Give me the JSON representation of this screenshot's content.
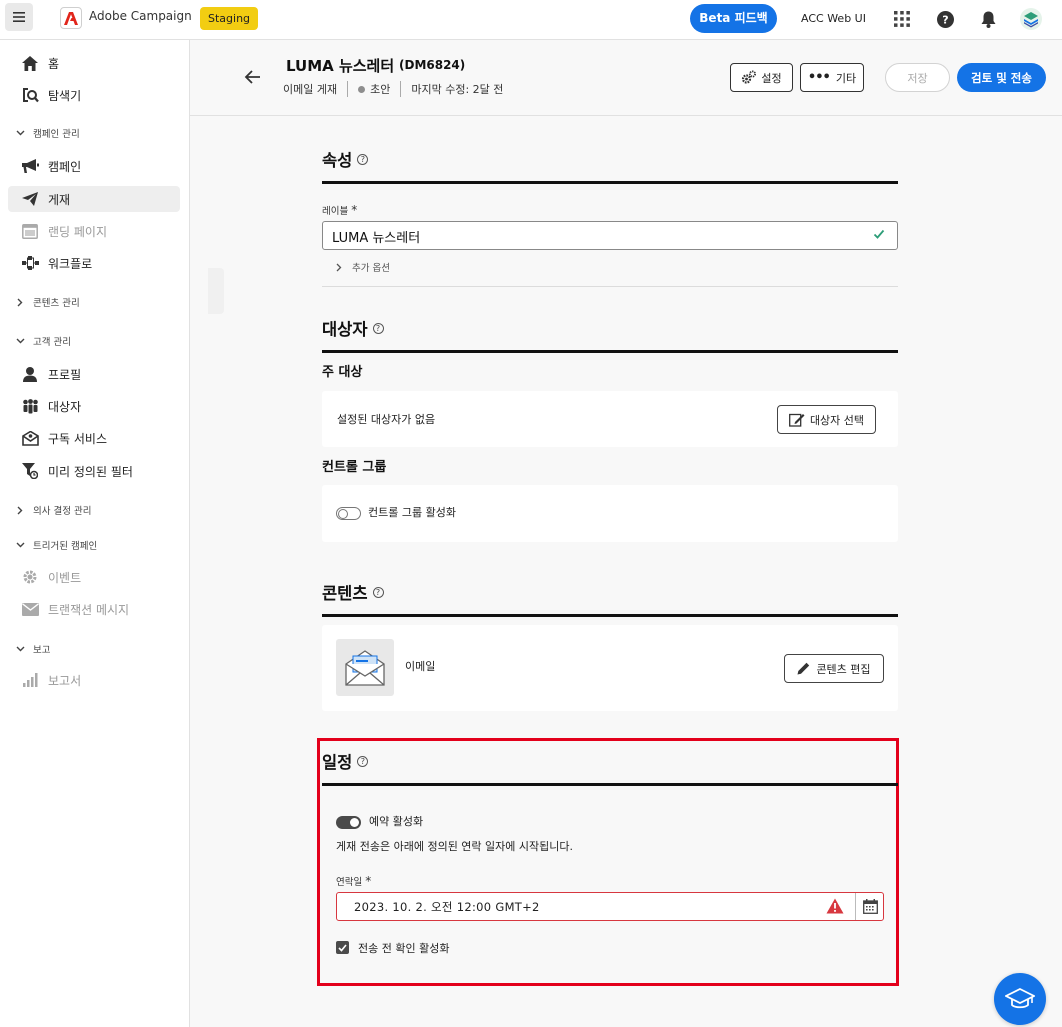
{
  "topbar": {
    "app_name": "Adobe Campaign",
    "env_badge": "Staging",
    "beta_feedback": "Beta 피드백",
    "acc_web_ui": "ACC Web UI"
  },
  "sidebar": {
    "items": [
      {
        "label": "홈",
        "icon": "home-icon"
      },
      {
        "label": "탐색기",
        "icon": "explorer-icon"
      },
      {
        "section": "캠페인 관리"
      },
      {
        "label": "캠페인",
        "icon": "megaphone-icon"
      },
      {
        "label": "게재",
        "icon": "paper-plane-icon",
        "active": true
      },
      {
        "label": "랜딩 페이지",
        "icon": "landing-page-icon",
        "disabled": true
      },
      {
        "label": "워크플로",
        "icon": "workflow-icon"
      },
      {
        "section": "콘텐츠 관리"
      },
      {
        "section": "고객 관리"
      },
      {
        "label": "프로필",
        "icon": "profile-icon"
      },
      {
        "label": "대상자",
        "icon": "audience-icon"
      },
      {
        "label": "구독 서비스",
        "icon": "subscription-icon"
      },
      {
        "label": "미리 정의된 필터",
        "icon": "filter-icon"
      },
      {
        "section": "의사 결정 관리"
      },
      {
        "section": "트리거된 캠페인"
      },
      {
        "label": "이벤트",
        "icon": "gear-icon",
        "disabled": true
      },
      {
        "label": "트랜잭션 메시지",
        "icon": "mail-icon",
        "disabled": true
      },
      {
        "section": "보고"
      },
      {
        "label": "보고서",
        "icon": "chart-icon",
        "disabled": true
      }
    ]
  },
  "header": {
    "title": "LUMA 뉴스레터",
    "id": "(DM6824)",
    "channel": "이메일 게재",
    "status": "초안",
    "last_modified": "마지막 수정: 2달 전",
    "settings_label": "설정",
    "more_label": "기타",
    "save_label": "저장",
    "review_send_label": "검토 및 전송"
  },
  "properties": {
    "title": "속성",
    "label_field_label": "레이블",
    "required_mark": "*",
    "label_value": "LUMA 뉴스레터",
    "more_options": "추가 옵션"
  },
  "audience": {
    "title": "대상자",
    "main_target_title": "주 대상",
    "no_audience_text": "설정된 대상자가 없음",
    "select_audience_label": "대상자 선택",
    "control_group_title": "컨트롤 그룹",
    "control_group_toggle_label": "컨트롤 그룹 활성화",
    "control_group_enabled": false
  },
  "content": {
    "title": "콘텐츠",
    "email_label": "이메일",
    "edit_content_label": "콘텐츠 편집"
  },
  "schedule": {
    "title": "일정",
    "enable_toggle_label": "예약 활성화",
    "enabled": true,
    "description": "게재 전송은 아래에 정의된 연락 일자에 시작됩니다.",
    "contact_date_label": "연락일",
    "contact_date_value": "2023. 10.  2. 오전  12:00 GMT+2",
    "confirm_label": "전송 전 확인 활성화",
    "confirm_checked": true
  },
  "colors": {
    "accent": "#1473e6",
    "staging_badge": "#f2cd12",
    "highlight": "#e3001b",
    "error": "#d7373f",
    "valid": "#2d9d78"
  }
}
